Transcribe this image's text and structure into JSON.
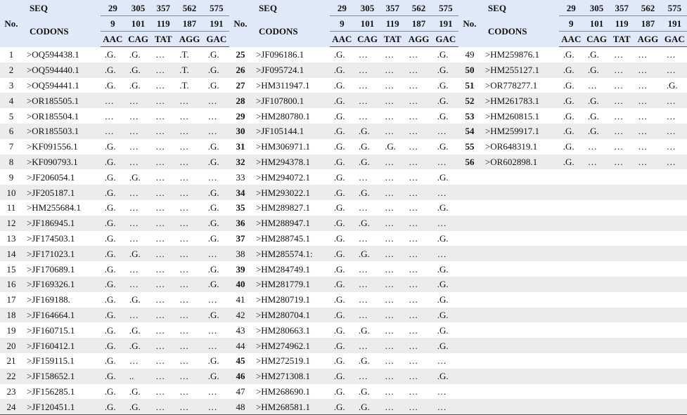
{
  "header": {
    "no_label": "No.",
    "seq_label": "SEQ",
    "codons_label": "CODONS",
    "positions": [
      "29",
      "305",
      "357",
      "562",
      "575"
    ],
    "codon_positions": [
      "9",
      "101",
      "119",
      "187",
      "191"
    ],
    "codons": [
      "AAC",
      "CAG",
      "TAT",
      "AGG",
      "GAC"
    ]
  },
  "rows": [
    {
      "no": "1",
      "acc": ">OQ594438.1",
      "c": [
        ".G.",
        ".G.",
        "…",
        ".T.",
        ".G."
      ]
    },
    {
      "no": "2",
      "acc": ">OQ594440.1",
      "c": [
        ".G.",
        ".G.",
        "…",
        ".T.",
        ".G."
      ]
    },
    {
      "no": "3",
      "acc": ">OQ594441.1",
      "c": [
        ".G.",
        ".G.",
        "…",
        ".T.",
        ".G."
      ]
    },
    {
      "no": "4",
      "acc": ">OR185505.1",
      "c": [
        "…",
        "…",
        "…",
        "…",
        "…"
      ]
    },
    {
      "no": "5",
      "acc": ">OR185504.1",
      "c": [
        "…",
        "…",
        "…",
        "…",
        "…"
      ]
    },
    {
      "no": "6",
      "acc": ">OR185503.1",
      "c": [
        "…",
        "…",
        "…",
        "…",
        "…"
      ]
    },
    {
      "no": "7",
      "acc": ">KF091556.1",
      "c": [
        ".G.",
        "…",
        "…",
        "…",
        ".G."
      ]
    },
    {
      "no": "8",
      "acc": ">KF090793.1",
      "c": [
        ".G.",
        "…",
        "…",
        "…",
        ".G."
      ]
    },
    {
      "no": "9",
      "acc": ">JF206054.1",
      "c": [
        ".G.",
        ".G.",
        "…",
        "…",
        "…"
      ]
    },
    {
      "no": "10",
      "acc": ">JF205187.1",
      "c": [
        ".G.",
        "…",
        "…",
        "…",
        ".G."
      ]
    },
    {
      "no": "11",
      "acc": ">HM255684.1",
      "c": [
        ".G.",
        "…",
        "…",
        "…",
        ".G."
      ]
    },
    {
      "no": "12",
      "acc": ">JF186945.1",
      "c": [
        ".G.",
        "…",
        "…",
        "…",
        ".G."
      ]
    },
    {
      "no": "13",
      "acc": ">JF174503.1",
      "c": [
        ".G.",
        "…",
        "…",
        "…",
        ".G."
      ]
    },
    {
      "no": "14",
      "acc": ">JF171023.1",
      "c": [
        ".G.",
        ".G.",
        "…",
        "…",
        "…"
      ]
    },
    {
      "no": "15",
      "acc": ">JF170689.1",
      "c": [
        ".G.",
        "…",
        "…",
        "…",
        ".G."
      ]
    },
    {
      "no": "16",
      "acc": ">JF169326.1",
      "c": [
        ".G.",
        "…",
        "…",
        "…",
        ".G."
      ]
    },
    {
      "no": "17",
      "acc": ">JF169188.",
      "c": [
        ".G.",
        ".G.",
        "…",
        "…",
        "…"
      ]
    },
    {
      "no": "18",
      "acc": ">JF164664.1",
      "c": [
        ".G.",
        "…",
        "…",
        "…",
        ".G."
      ]
    },
    {
      "no": "19",
      "acc": ">JF160715.1",
      "c": [
        ".G.",
        ".G.",
        "…",
        "…",
        "…"
      ]
    },
    {
      "no": "20",
      "acc": ">JF160412.1",
      "c": [
        ".G.",
        ".G.",
        "…",
        "…",
        "…"
      ]
    },
    {
      "no": "21",
      "acc": ">JF159115.1",
      "c": [
        ".G.",
        "…",
        "…",
        "…",
        ".G."
      ]
    },
    {
      "no": "22",
      "acc": ">JF158652.1",
      "c": [
        ".G.",
        "..",
        "…",
        "…",
        ".G."
      ]
    },
    {
      "no": "23",
      "acc": ">JF156285.1",
      "c": [
        ".G.",
        ".G.",
        "…",
        "…",
        "…"
      ]
    },
    {
      "no": "24",
      "acc": ">JF120451.1",
      "c": [
        ".G.",
        ".G.",
        "…",
        "…",
        "…"
      ]
    },
    {
      "no": "25",
      "acc": ">JF096186.1",
      "c": [
        ".G.",
        "…",
        "…",
        "…",
        ".G."
      ]
    },
    {
      "no": "26",
      "acc": ">JF095724.1",
      "c": [
        ".G.",
        "…",
        "…",
        "…",
        ".G."
      ]
    },
    {
      "no": "27",
      "acc": ">HM311947.1",
      "c": [
        ".G.",
        "…",
        "…",
        "…",
        ".G."
      ]
    },
    {
      "no": "28",
      "acc": ">JF107800.1",
      "c": [
        ".G.",
        "…",
        "…",
        "…",
        ".G."
      ]
    },
    {
      "no": "29",
      "acc": ">HM280780.1",
      "c": [
        ".G.",
        "…",
        "…",
        "…",
        ".G."
      ]
    },
    {
      "no": "30",
      "acc": ">JF105144.1",
      "c": [
        ".G.",
        ".G.",
        "…",
        "…",
        "…"
      ]
    },
    {
      "no": "31",
      "acc": ">HM306971.1",
      "c": [
        ".G.",
        ".G.",
        ".G.",
        "…",
        ".G."
      ]
    },
    {
      "no": "32",
      "acc": ">HM294378.1",
      "c": [
        ".G.",
        ".G.",
        "…",
        "…",
        "…"
      ]
    },
    {
      "no": "33",
      "acc": ">HM294072.1",
      "c": [
        ".G.",
        "…",
        "…",
        "…",
        ".G."
      ]
    },
    {
      "no": "34",
      "acc": ">HM293022.1",
      "c": [
        ".G.",
        ".G.",
        "…",
        "…",
        "…"
      ]
    },
    {
      "no": "35",
      "acc": ">HM289827.1",
      "c": [
        ".G.",
        "…",
        "…",
        "…",
        ".G."
      ]
    },
    {
      "no": "36",
      "acc": ">HM288947.1",
      "c": [
        ".G.",
        ".G.",
        "…",
        "…",
        "…"
      ]
    },
    {
      "no": "37",
      "acc": ">HM288745.1",
      "c": [
        ".G.",
        "…",
        "…",
        "…",
        ".G."
      ]
    },
    {
      "no": "38",
      "acc": ">HM285574.1:",
      "c": [
        ".G.",
        ".G.",
        "…",
        "…",
        "…"
      ]
    },
    {
      "no": "39",
      "acc": ">HM284749.1",
      "c": [
        ".G.",
        "…",
        "…",
        "…",
        ".G."
      ]
    },
    {
      "no": "40",
      "acc": ">HM281779.1",
      "c": [
        ".G.",
        "…",
        "…",
        "…",
        ".G."
      ]
    },
    {
      "no": "41",
      "acc": ">HM280719.1",
      "c": [
        ".G.",
        "…",
        "…",
        "…",
        ".G."
      ]
    },
    {
      "no": "42",
      "acc": ">HM280704.1",
      "c": [
        ".G.",
        "…",
        "…",
        "…",
        ".G."
      ]
    },
    {
      "no": "43",
      "acc": ">HM280663.1",
      "c": [
        ".G.",
        ".G.",
        "…",
        "…",
        ".G."
      ]
    },
    {
      "no": "44",
      "acc": ">HM274962.1",
      "c": [
        ".G.",
        "…",
        "…",
        "…",
        ".G."
      ]
    },
    {
      "no": "45",
      "acc": ">HM272519.1",
      "c": [
        ".G.",
        ".G.",
        "…",
        "…",
        "…"
      ]
    },
    {
      "no": "46",
      "acc": ">HM271308.1",
      "c": [
        ".G.",
        "…",
        "…",
        "…",
        ".G."
      ]
    },
    {
      "no": "47",
      "acc": ">HM268690.1",
      "c": [
        ".G.",
        ".G.",
        "…",
        "…",
        "…"
      ]
    },
    {
      "no": "48",
      "acc": ">HM268581.1",
      "c": [
        ".G.",
        ".G.",
        "…",
        "…",
        "…"
      ]
    },
    {
      "no": "49",
      "acc": ">HM259876.1",
      "c": [
        ".G.",
        ".G.",
        "…",
        "…",
        "…"
      ]
    },
    {
      "no": "50",
      "acc": ">HM255127.1",
      "c": [
        ".G.",
        ".G.",
        "…",
        "…",
        "…"
      ]
    },
    {
      "no": "51",
      "acc": ">OR778277.1",
      "c": [
        ".G.",
        "…",
        "…",
        "…",
        ".G."
      ]
    },
    {
      "no": "52",
      "acc": ">HM261783.1",
      "c": [
        ".G.",
        ".G.",
        "…",
        "…",
        "…"
      ]
    },
    {
      "no": "53",
      "acc": ">HM260815.1",
      "c": [
        ".G.",
        ".G.",
        "…",
        "…",
        "…"
      ]
    },
    {
      "no": "54",
      "acc": ">HM259917.1",
      "c": [
        ".G.",
        ".G.",
        "…",
        "…",
        "…"
      ]
    },
    {
      "no": "55",
      "acc": ">OR648319.1",
      "c": [
        ".G.",
        "…",
        "…",
        "…",
        "…"
      ]
    },
    {
      "no": "56",
      "acc": ">OR602898.1",
      "c": [
        ".G.",
        "…",
        "…",
        "…",
        "…"
      ]
    }
  ],
  "bold_numbers": [
    "25",
    "26",
    "27",
    "28",
    "29",
    "30",
    "31",
    "32",
    "34",
    "35",
    "36",
    "37",
    "39",
    "40",
    "45",
    "46",
    "50",
    "51",
    "52",
    "53",
    "54",
    "55",
    "56"
  ]
}
